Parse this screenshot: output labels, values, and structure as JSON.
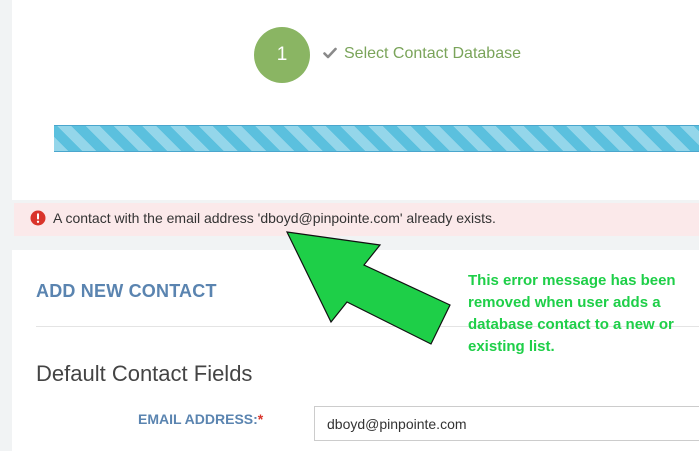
{
  "wizard": {
    "step_number": "1",
    "step_label": "Select Contact Database",
    "step_color": "#8ab563",
    "progress_color": "#5bc0de"
  },
  "alert": {
    "message": "A contact with the email address 'dboyd@pinpointe.com' already exists.",
    "icon": "exclamation-circle-icon",
    "background": "#fbe9ea",
    "icon_color": "#d9342b"
  },
  "form": {
    "header": "ADD NEW CONTACT",
    "section_title": "Default Contact Fields",
    "email_label": "EMAIL ADDRESS:",
    "required_marker": "*",
    "email_value": "dboyd@pinpointe.com",
    "accent_color": "#5a84b0"
  },
  "annotation": {
    "text": "This error message has been removed when user adds a database contact to a new or existing list.",
    "color": "#1ecf48"
  }
}
